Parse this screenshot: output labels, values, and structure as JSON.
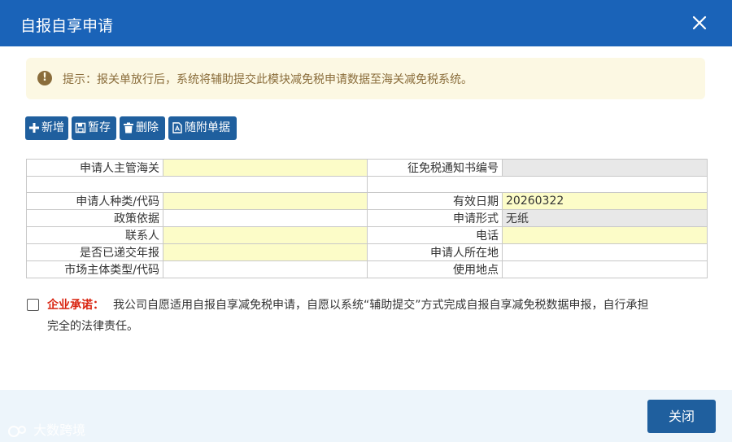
{
  "dialog": {
    "title": "自报自享申请"
  },
  "notice": {
    "prefix": "提示：",
    "text": "报关单放行后，系统将辅助提交此模块减免税申请数据至海关减免税系统。"
  },
  "toolbar": {
    "add_label": "新增",
    "save_label": "暂存",
    "delete_label": "删除",
    "attach_label": "随附单据"
  },
  "form": {
    "customs_label": "申请人主管海关",
    "customs_value": "",
    "notice_no_label": "征免税通知书编号",
    "notice_no_value": "",
    "applicant_type_label": "申请人种类/代码",
    "applicant_type_value": "",
    "valid_date_label": "有效日期",
    "valid_date_value": "20260322",
    "policy_label": "政策依据",
    "policy_value": "",
    "apply_form_label": "申请形式",
    "apply_form_value": "无纸",
    "contact_label": "联系人",
    "contact_value": "",
    "phone_label": "电话",
    "phone_value": "",
    "annual_report_label": "是否已递交年报",
    "annual_report_value": "",
    "location_label": "申请人所在地",
    "location_value": "",
    "market_type_label": "市场主体类型/代码",
    "market_type_value": "",
    "use_place_label": "使用地点",
    "use_place_value": ""
  },
  "pledge": {
    "head": "企业承诺：",
    "line1": "我公司自愿适用自报自享减免税申请，自愿以系统“辅助提交”方式完成自报自享减免税数据申报，自行承担",
    "line2": "完全的法律责任。"
  },
  "footer": {
    "close_label": "关闭",
    "watermark": "大数跨境"
  },
  "colors": {
    "primary": "#1a63b8",
    "button": "#1f5f9e",
    "required_field": "#fcfcc8",
    "readonly_field": "#e8e8e8",
    "warning_text": "#8a6d3b",
    "pledge_head": "#d9230f"
  }
}
